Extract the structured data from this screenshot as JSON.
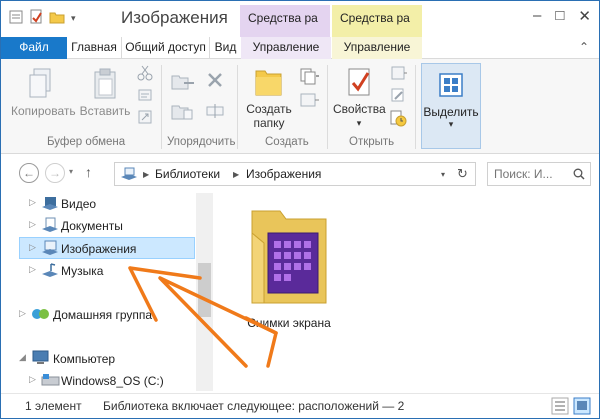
{
  "window": {
    "title": "Изображения",
    "context_tab_pictures": "Средства ра",
    "context_tab_library": "Средства ра"
  },
  "tabs": {
    "file": "Файл",
    "home": "Главная",
    "share": "Общий доступ",
    "view": "Вид",
    "manage1": "Управление",
    "manage2": "Управление"
  },
  "ribbon": {
    "copy": "Копировать",
    "paste": "Вставить",
    "clipboard_group": "Буфер обмена",
    "organize_group": "Упорядочить",
    "new_folder_line1": "Создать",
    "new_folder_line2": "папку",
    "create_group": "Создать",
    "properties": "Свойства",
    "open_group": "Открыть",
    "select": "Выделить"
  },
  "address": {
    "crumb1": "Библиотеки",
    "crumb2": "Изображения",
    "search_placeholder": "Поиск: И..."
  },
  "nav_tree": {
    "video": "Видео",
    "documents": "Документы",
    "images": "Изображения",
    "music": "Музыка",
    "homegroup": "Домашняя группа",
    "computer": "Компьютер",
    "drive_c": "Windows8_OS (C:)"
  },
  "content": {
    "folder_name": "Снимки экрана"
  },
  "status": {
    "count": "1 элемент",
    "library_info": "Библиотека включает следующее: расположений — 2"
  },
  "colors": {
    "file_tab": "#1979ca",
    "ctx_pictures": "#e4d4f0",
    "ctx_library": "#f3efa8",
    "selection": "#cce8ff",
    "annotation_arrow": "#f07a1a"
  }
}
